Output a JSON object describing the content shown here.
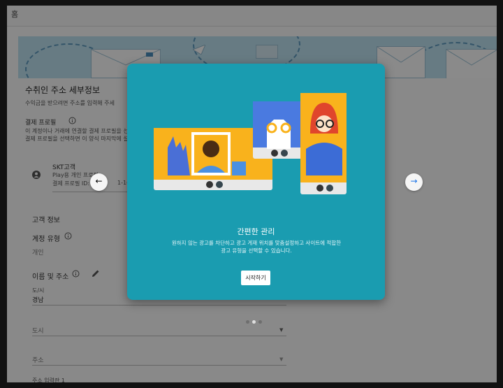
{
  "topbar": {
    "home": "홈"
  },
  "form": {
    "section_title": "수취인 주소 세부정보",
    "section_desc": "수익금을 받으려면 주소를 입력해 주세",
    "profile_label": "결제 프로필",
    "profile_desc_1": "이 계정이나 거래에 연결할 결제 프로필을 선택",
    "profile_desc_2": "결제 프로필을 선택하면 이 양식 마지막에 설정",
    "profile_name": "SKT고객",
    "profile_type": "Play용 개인 프로필",
    "profile_id": "결제 프로필 ID: 79",
    "profile_id_tail": "1-1607",
    "customer_info": "고객 정보",
    "account_type_label": "계정 유형",
    "account_type_value": "개인",
    "name_address_label": "이름 및 주소",
    "province_label": "도/시",
    "province_value": "경남",
    "city_label": "도시",
    "address_label": "주소",
    "address_line1_label": "주소 입력란 1"
  },
  "dialog": {
    "title": "간편한 관리",
    "desc": "원하지 않는 광고를 차단하고 광고 게재 위치를 맞춤설정하고 사이트에 적합한 광고 유형을 선택할 수 있습니다.",
    "start_button": "시작하기",
    "prev_icon": "arrow-left-icon",
    "next_icon": "arrow-right-icon",
    "pagination": {
      "current": 2,
      "total": 3
    }
  },
  "colors": {
    "dialog_bg": "#1a9cb0",
    "accent_yellow": "#f9b21c",
    "accent_blue": "#4285f4"
  }
}
